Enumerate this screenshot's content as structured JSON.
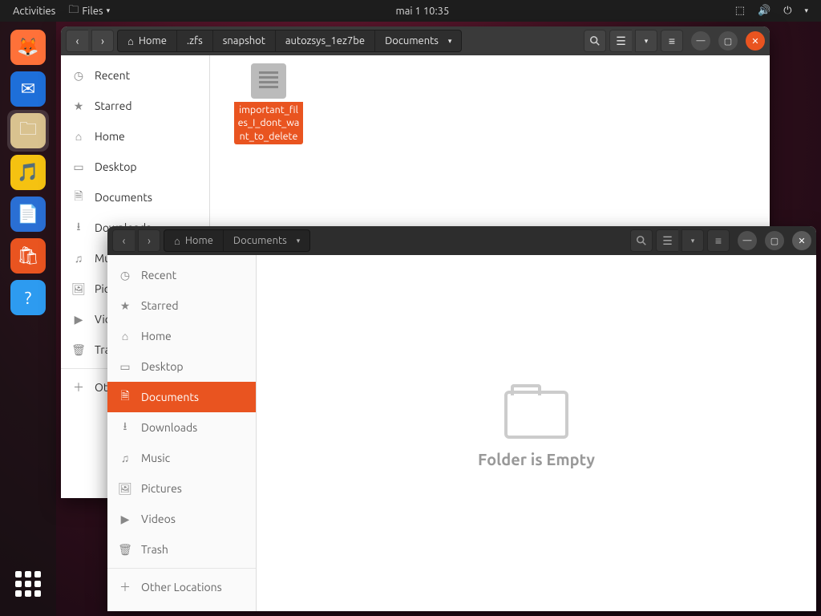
{
  "topbar": {
    "activities": "Activities",
    "app_menu": "Files",
    "clock": "mai 1  10:35"
  },
  "dock": {
    "items": [
      {
        "name": "firefox",
        "color": "#ff7139"
      },
      {
        "name": "thunderbird",
        "color": "#1e6fd9"
      },
      {
        "name": "files",
        "color": "#d9c28f",
        "selected": true
      },
      {
        "name": "rhythmbox",
        "color": "#f5c211"
      },
      {
        "name": "libreoffice-writer",
        "color": "#2a6fd4"
      },
      {
        "name": "software",
        "color": "#e95420"
      },
      {
        "name": "help",
        "color": "#2d9bf0"
      }
    ]
  },
  "window1": {
    "path": [
      "Home",
      ".zfs",
      "snapshot",
      "autozsys_1ez7be",
      "Documents"
    ],
    "sidebar": [
      {
        "icon": "clock",
        "label": "Recent"
      },
      {
        "icon": "star",
        "label": "Starred"
      },
      {
        "icon": "home",
        "label": "Home"
      },
      {
        "icon": "desktop",
        "label": "Desktop"
      },
      {
        "icon": "documents",
        "label": "Documents"
      },
      {
        "icon": "download",
        "label": "Downloads"
      },
      {
        "icon": "music",
        "label": "Music"
      },
      {
        "icon": "pictures",
        "label": "Pictures"
      },
      {
        "icon": "videos",
        "label": "Videos"
      },
      {
        "icon": "trash",
        "label": "Trash"
      },
      {
        "sep": true
      },
      {
        "icon": "plus",
        "label": "Other Locations"
      }
    ],
    "files": [
      {
        "name": "important_files_I_dont_want_to_delete"
      }
    ]
  },
  "window2": {
    "path": [
      "Home",
      "Documents"
    ],
    "sidebar": [
      {
        "icon": "clock",
        "label": "Recent"
      },
      {
        "icon": "star",
        "label": "Starred"
      },
      {
        "icon": "home",
        "label": "Home"
      },
      {
        "icon": "desktop",
        "label": "Desktop"
      },
      {
        "icon": "documents",
        "label": "Documents",
        "selected": true
      },
      {
        "icon": "download",
        "label": "Downloads"
      },
      {
        "icon": "music",
        "label": "Music"
      },
      {
        "icon": "pictures",
        "label": "Pictures"
      },
      {
        "icon": "videos",
        "label": "Videos"
      },
      {
        "icon": "trash",
        "label": "Trash"
      },
      {
        "sep": true
      },
      {
        "icon": "plus",
        "label": "Other Locations"
      }
    ],
    "empty_label": "Folder is Empty"
  }
}
